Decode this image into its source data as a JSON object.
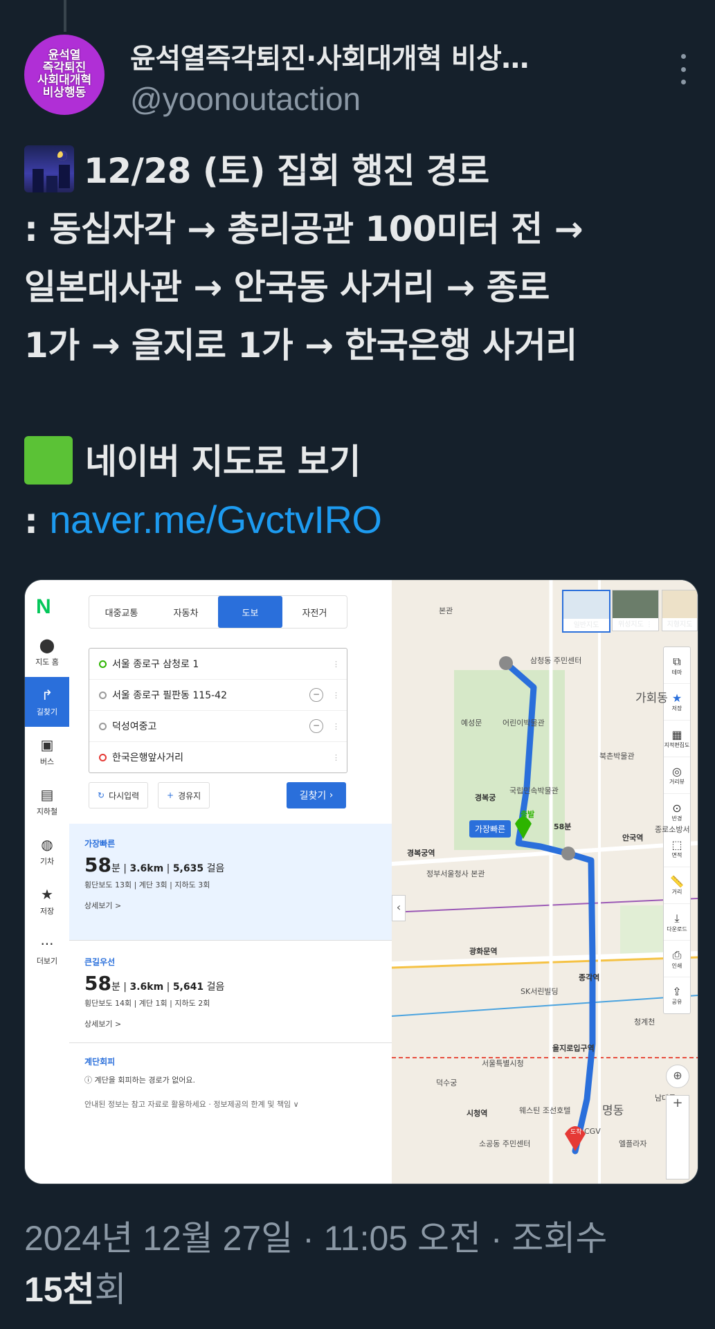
{
  "author": {
    "display_name": "윤석열즉각퇴진·사회대개혁 비상…",
    "handle": "@yoonoutaction",
    "avatar_lines": [
      "윤석열",
      "즉각퇴진",
      "사회대개혁",
      "비상행동"
    ]
  },
  "tweet": {
    "lines": [
      "12/28 (토) 집회 행진 경로",
      ": 동십자각 → 총리공관 100미터 전 →",
      "일본대사관 → 안국동 사거리 → 종로",
      "1가 → 을지로 1가 → 한국은행 사거리",
      "",
      "네이버 지도로 보기"
    ],
    "link_prefix": ": ",
    "link_text": "naver.me/GvctvIRO"
  },
  "map_screenshot": {
    "rail": [
      "지도 홈",
      "길찾기",
      "버스",
      "지하철",
      "기차",
      "저장",
      "더보기"
    ],
    "modes": [
      "대중교통",
      "자동차",
      "도보",
      "자전거"
    ],
    "waypoints": [
      "서울 종로구 삼청로 1",
      "서울 종로구 필판동 115-42",
      "덕성여중고",
      "한국은행앞사거리"
    ],
    "reset_label": "다시입력",
    "via_label": "경유지",
    "search_label": "길찾기",
    "routes": [
      {
        "tag": "가장빠른",
        "minutes": "58",
        "min_unit": "분",
        "distance": "3.6km",
        "steps": "5,635",
        "steps_unit": "걸음",
        "sub": "횡단보도 13회 | 계단 3회 | 지하도 3회",
        "detail": "상세보기 >"
      },
      {
        "tag": "큰길우선",
        "minutes": "58",
        "min_unit": "분",
        "distance": "3.6km",
        "steps": "5,641",
        "steps_unit": "걸음",
        "sub": "횡단보도 14회 | 계단 1회 | 지하도 2회",
        "detail": "상세보기 >"
      }
    ],
    "avoid_stairs": {
      "tag": "계단회피",
      "text": "계단을 회피하는 경로가 없어요."
    },
    "notice": "안내된 정보는 참고 자료로 활용하세요 · 정보제공의 한계 및 책임 ∨",
    "map_types": [
      "일반지도",
      "위성지도 ⋮",
      "지형지도"
    ],
    "tools": [
      "테마",
      "저장",
      "지적편집도",
      "거리뷰",
      "반경",
      "면적",
      "거리",
      "다운로드",
      "인쇄",
      "공유"
    ],
    "labels": [
      "본관",
      "삼청동 주민센터",
      "가회동",
      "예성문",
      "어린이박물관",
      "경복궁",
      "국립민속박물관",
      "북촌박물관",
      "안국역",
      "종로소방서",
      "경복궁역",
      "정부서울청사 본관",
      "광화문역",
      "종각역",
      "청계천",
      "을지로입구역",
      "덕수궁",
      "시청역",
      "명동",
      "웨스틴 조선호텔",
      "소공동 주민센터",
      "SK서린빌딩",
      "서울특별시청",
      "CGV",
      "엘플라자",
      "남대문"
    ],
    "start_badge": "가장빠른",
    "start_label": "출발",
    "end_label": "도착",
    "duration_badge": "58분"
  },
  "footer": {
    "timestamp": "2024년 12월 27일 · 11:05 오전 · 조회수",
    "views": "15천",
    "views_suffix": "회"
  },
  "colors": {
    "background": "#15202b",
    "text": "#e7e9ea",
    "muted": "#8b98a5",
    "link": "#1d9bf0",
    "avatar": "#b02fd6",
    "route": "#2a6fdb"
  }
}
